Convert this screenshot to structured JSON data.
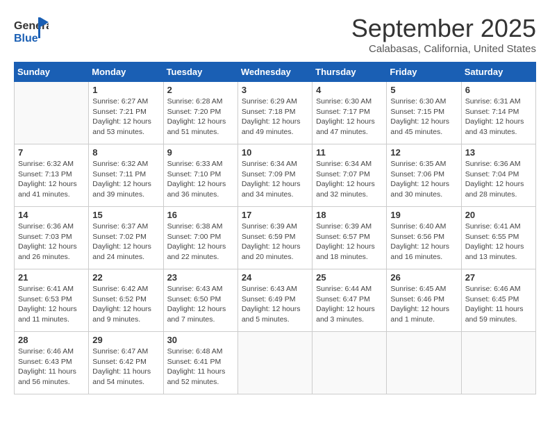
{
  "header": {
    "logo_general": "General",
    "logo_blue": "Blue",
    "month_title": "September 2025",
    "location": "Calabasas, California, United States"
  },
  "weekdays": [
    "Sunday",
    "Monday",
    "Tuesday",
    "Wednesday",
    "Thursday",
    "Friday",
    "Saturday"
  ],
  "weeks": [
    [
      {
        "day": "",
        "sunrise": "",
        "sunset": "",
        "daylight": ""
      },
      {
        "day": "1",
        "sunrise": "Sunrise: 6:27 AM",
        "sunset": "Sunset: 7:21 PM",
        "daylight": "Daylight: 12 hours and 53 minutes."
      },
      {
        "day": "2",
        "sunrise": "Sunrise: 6:28 AM",
        "sunset": "Sunset: 7:20 PM",
        "daylight": "Daylight: 12 hours and 51 minutes."
      },
      {
        "day": "3",
        "sunrise": "Sunrise: 6:29 AM",
        "sunset": "Sunset: 7:18 PM",
        "daylight": "Daylight: 12 hours and 49 minutes."
      },
      {
        "day": "4",
        "sunrise": "Sunrise: 6:30 AM",
        "sunset": "Sunset: 7:17 PM",
        "daylight": "Daylight: 12 hours and 47 minutes."
      },
      {
        "day": "5",
        "sunrise": "Sunrise: 6:30 AM",
        "sunset": "Sunset: 7:15 PM",
        "daylight": "Daylight: 12 hours and 45 minutes."
      },
      {
        "day": "6",
        "sunrise": "Sunrise: 6:31 AM",
        "sunset": "Sunset: 7:14 PM",
        "daylight": "Daylight: 12 hours and 43 minutes."
      }
    ],
    [
      {
        "day": "7",
        "sunrise": "Sunrise: 6:32 AM",
        "sunset": "Sunset: 7:13 PM",
        "daylight": "Daylight: 12 hours and 41 minutes."
      },
      {
        "day": "8",
        "sunrise": "Sunrise: 6:32 AM",
        "sunset": "Sunset: 7:11 PM",
        "daylight": "Daylight: 12 hours and 39 minutes."
      },
      {
        "day": "9",
        "sunrise": "Sunrise: 6:33 AM",
        "sunset": "Sunset: 7:10 PM",
        "daylight": "Daylight: 12 hours and 36 minutes."
      },
      {
        "day": "10",
        "sunrise": "Sunrise: 6:34 AM",
        "sunset": "Sunset: 7:09 PM",
        "daylight": "Daylight: 12 hours and 34 minutes."
      },
      {
        "day": "11",
        "sunrise": "Sunrise: 6:34 AM",
        "sunset": "Sunset: 7:07 PM",
        "daylight": "Daylight: 12 hours and 32 minutes."
      },
      {
        "day": "12",
        "sunrise": "Sunrise: 6:35 AM",
        "sunset": "Sunset: 7:06 PM",
        "daylight": "Daylight: 12 hours and 30 minutes."
      },
      {
        "day": "13",
        "sunrise": "Sunrise: 6:36 AM",
        "sunset": "Sunset: 7:04 PM",
        "daylight": "Daylight: 12 hours and 28 minutes."
      }
    ],
    [
      {
        "day": "14",
        "sunrise": "Sunrise: 6:36 AM",
        "sunset": "Sunset: 7:03 PM",
        "daylight": "Daylight: 12 hours and 26 minutes."
      },
      {
        "day": "15",
        "sunrise": "Sunrise: 6:37 AM",
        "sunset": "Sunset: 7:02 PM",
        "daylight": "Daylight: 12 hours and 24 minutes."
      },
      {
        "day": "16",
        "sunrise": "Sunrise: 6:38 AM",
        "sunset": "Sunset: 7:00 PM",
        "daylight": "Daylight: 12 hours and 22 minutes."
      },
      {
        "day": "17",
        "sunrise": "Sunrise: 6:39 AM",
        "sunset": "Sunset: 6:59 PM",
        "daylight": "Daylight: 12 hours and 20 minutes."
      },
      {
        "day": "18",
        "sunrise": "Sunrise: 6:39 AM",
        "sunset": "Sunset: 6:57 PM",
        "daylight": "Daylight: 12 hours and 18 minutes."
      },
      {
        "day": "19",
        "sunrise": "Sunrise: 6:40 AM",
        "sunset": "Sunset: 6:56 PM",
        "daylight": "Daylight: 12 hours and 16 minutes."
      },
      {
        "day": "20",
        "sunrise": "Sunrise: 6:41 AM",
        "sunset": "Sunset: 6:55 PM",
        "daylight": "Daylight: 12 hours and 13 minutes."
      }
    ],
    [
      {
        "day": "21",
        "sunrise": "Sunrise: 6:41 AM",
        "sunset": "Sunset: 6:53 PM",
        "daylight": "Daylight: 12 hours and 11 minutes."
      },
      {
        "day": "22",
        "sunrise": "Sunrise: 6:42 AM",
        "sunset": "Sunset: 6:52 PM",
        "daylight": "Daylight: 12 hours and 9 minutes."
      },
      {
        "day": "23",
        "sunrise": "Sunrise: 6:43 AM",
        "sunset": "Sunset: 6:50 PM",
        "daylight": "Daylight: 12 hours and 7 minutes."
      },
      {
        "day": "24",
        "sunrise": "Sunrise: 6:43 AM",
        "sunset": "Sunset: 6:49 PM",
        "daylight": "Daylight: 12 hours and 5 minutes."
      },
      {
        "day": "25",
        "sunrise": "Sunrise: 6:44 AM",
        "sunset": "Sunset: 6:47 PM",
        "daylight": "Daylight: 12 hours and 3 minutes."
      },
      {
        "day": "26",
        "sunrise": "Sunrise: 6:45 AM",
        "sunset": "Sunset: 6:46 PM",
        "daylight": "Daylight: 12 hours and 1 minute."
      },
      {
        "day": "27",
        "sunrise": "Sunrise: 6:46 AM",
        "sunset": "Sunset: 6:45 PM",
        "daylight": "Daylight: 11 hours and 59 minutes."
      }
    ],
    [
      {
        "day": "28",
        "sunrise": "Sunrise: 6:46 AM",
        "sunset": "Sunset: 6:43 PM",
        "daylight": "Daylight: 11 hours and 56 minutes."
      },
      {
        "day": "29",
        "sunrise": "Sunrise: 6:47 AM",
        "sunset": "Sunset: 6:42 PM",
        "daylight": "Daylight: 11 hours and 54 minutes."
      },
      {
        "day": "30",
        "sunrise": "Sunrise: 6:48 AM",
        "sunset": "Sunset: 6:41 PM",
        "daylight": "Daylight: 11 hours and 52 minutes."
      },
      {
        "day": "",
        "sunrise": "",
        "sunset": "",
        "daylight": ""
      },
      {
        "day": "",
        "sunrise": "",
        "sunset": "",
        "daylight": ""
      },
      {
        "day": "",
        "sunrise": "",
        "sunset": "",
        "daylight": ""
      },
      {
        "day": "",
        "sunrise": "",
        "sunset": "",
        "daylight": ""
      }
    ]
  ]
}
